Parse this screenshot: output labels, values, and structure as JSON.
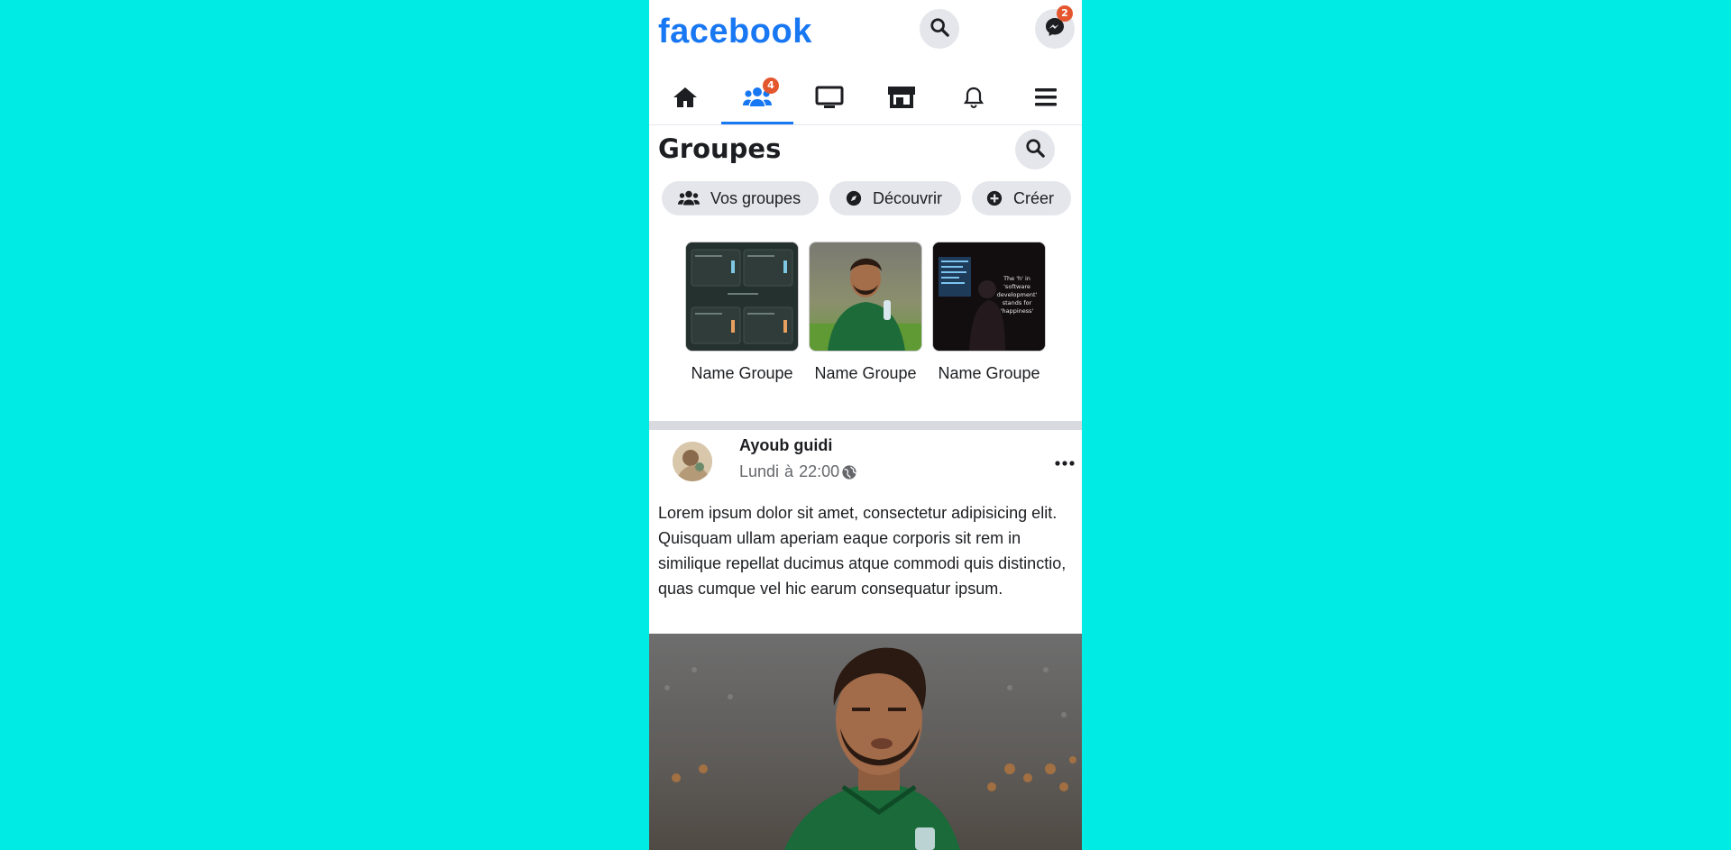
{
  "header": {
    "logo": "facebook",
    "search_icon": "search-icon",
    "messenger_icon": "messenger-icon",
    "messenger_badge": "2"
  },
  "nav": {
    "items": [
      {
        "name": "home",
        "icon": "home-icon"
      },
      {
        "name": "groups",
        "icon": "users-icon",
        "badge": "4",
        "active": true
      },
      {
        "name": "watch",
        "icon": "monitor-icon"
      },
      {
        "name": "marketplace",
        "icon": "store-icon"
      },
      {
        "name": "notifications",
        "icon": "bell-icon"
      },
      {
        "name": "menu",
        "icon": "hamburger-icon"
      }
    ]
  },
  "groups": {
    "title": "Groupes",
    "search_icon": "search-icon",
    "chips": [
      {
        "label": "Vos groupes",
        "icon": "users-icon"
      },
      {
        "label": "Découvrir",
        "icon": "compass-icon"
      },
      {
        "label": "Créer",
        "icon": "plus-circle-icon"
      }
    ],
    "cards": [
      {
        "name": "Name Groupe"
      },
      {
        "name": "Name Groupe"
      },
      {
        "name": "Name Groupe",
        "thumb_text": "The 'h' in 'software development' stands for 'happiness'"
      }
    ]
  },
  "post": {
    "author": "Ayoub guidi",
    "day": "Lundi",
    "at": "à",
    "time": "22:00",
    "privacy_icon": "globe-icon",
    "more_icon": "more-horizontal-icon",
    "text": "Lorem ipsum dolor sit amet, consectetur adipisicing elit. Quisquam ullam aperiam eaque corporis sit rem in similique repellat ducimus atque commodi quis distinctio, quas cumque vel hic earum consequatur ipsum."
  },
  "colors": {
    "background": "#00ebe4",
    "brand": "#1877f2",
    "badge": "#e4572e"
  }
}
